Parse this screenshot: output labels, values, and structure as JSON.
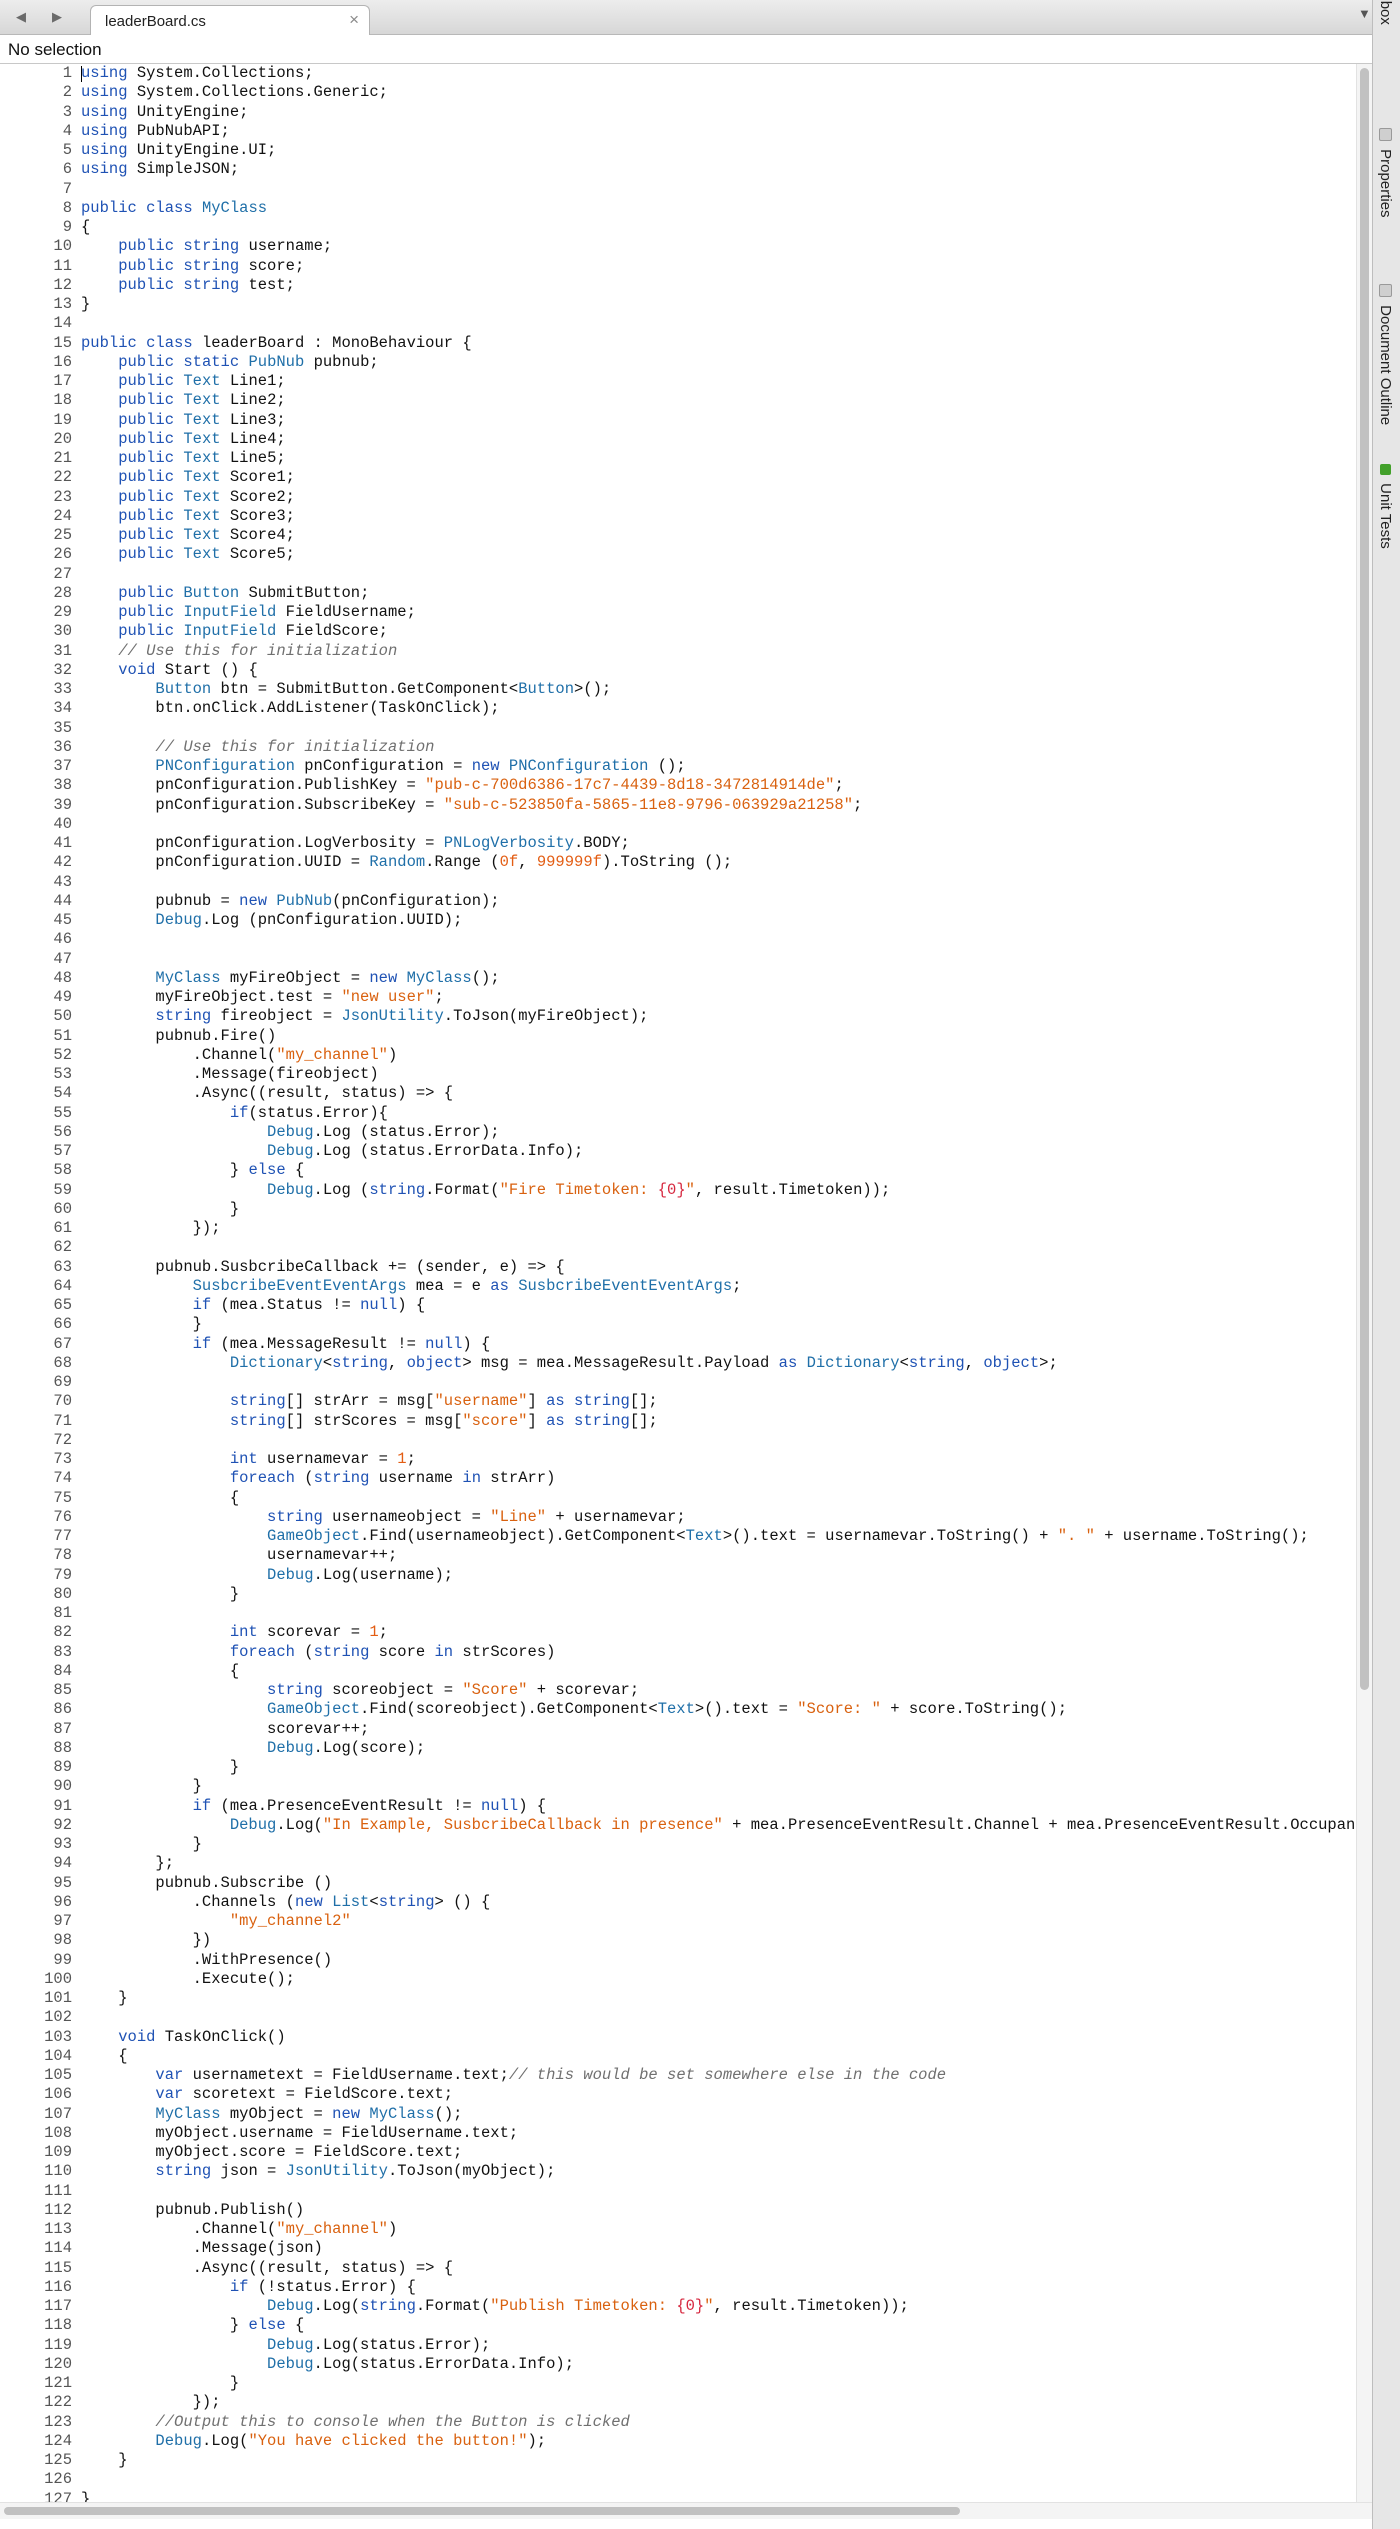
{
  "tab_bar": {
    "back_glyph": "◀",
    "forward_glyph": "▶",
    "tab_title": "leaderBoard.cs",
    "close_glyph": "×",
    "menu_glyph": "▼"
  },
  "selection_status": "No selection",
  "side_panel": {
    "tabs": [
      "Toolbox",
      "Properties",
      "Document Outline",
      "Unit Tests"
    ]
  },
  "editor": {
    "colors": {
      "keyword": "#1f52b4",
      "type": "#1f6fa8",
      "string": "#d9610f",
      "number": "#e35d13",
      "comment": "#707070",
      "placeholder": "#d6263e"
    },
    "lines": [
      "using System.Collections;",
      "using System.Collections.Generic;",
      "using UnityEngine;",
      "using PubNubAPI;",
      "using UnityEngine.UI;",
      "using SimpleJSON;",
      "",
      "public class MyClass",
      "{",
      "    public string username;",
      "    public string score;",
      "    public string test;",
      "}",
      "",
      "public class leaderBoard : MonoBehaviour {",
      "    public static PubNub pubnub;",
      "    public Text Line1;",
      "    public Text Line2;",
      "    public Text Line3;",
      "    public Text Line4;",
      "    public Text Line5;",
      "    public Text Score1;",
      "    public Text Score2;",
      "    public Text Score3;",
      "    public Text Score4;",
      "    public Text Score5;",
      "",
      "    public Button SubmitButton;",
      "    public InputField FieldUsername;",
      "    public InputField FieldScore;",
      "    // Use this for initialization",
      "    void Start () {",
      "        Button btn = SubmitButton.GetComponent<Button>();",
      "        btn.onClick.AddListener(TaskOnClick);",
      "",
      "        // Use this for initialization",
      "        PNConfiguration pnConfiguration = new PNConfiguration ();",
      "        pnConfiguration.PublishKey = \"pub-c-700d6386-17c7-4439-8d18-3472814914de\";",
      "        pnConfiguration.SubscribeKey = \"sub-c-523850fa-5865-11e8-9796-063929a21258\";",
      "",
      "        pnConfiguration.LogVerbosity = PNLogVerbosity.BODY;",
      "        pnConfiguration.UUID = Random.Range (0f, 999999f).ToString ();",
      "",
      "        pubnub = new PubNub(pnConfiguration);",
      "        Debug.Log (pnConfiguration.UUID);",
      "",
      "",
      "        MyClass myFireObject = new MyClass();",
      "        myFireObject.test = \"new user\";",
      "        string fireobject = JsonUtility.ToJson(myFireObject);",
      "        pubnub.Fire()",
      "            .Channel(\"my_channel\")",
      "            .Message(fireobject)",
      "            .Async((result, status) => {",
      "                if(status.Error){",
      "                    Debug.Log (status.Error);",
      "                    Debug.Log (status.ErrorData.Info);",
      "                } else {",
      "                    Debug.Log (string.Format(\"Fire Timetoken: {0}\", result.Timetoken));",
      "                }",
      "            });",
      "",
      "        pubnub.SusbcribeCallback += (sender, e) => {",
      "            SusbcribeEventEventArgs mea = e as SusbcribeEventEventArgs;",
      "            if (mea.Status != null) {",
      "            }",
      "            if (mea.MessageResult != null) {",
      "                Dictionary<string, object> msg = mea.MessageResult.Payload as Dictionary<string, object>;",
      "",
      "                string[] strArr = msg[\"username\"] as string[];",
      "                string[] strScores = msg[\"score\"] as string[];",
      "",
      "                int usernamevar = 1;",
      "                foreach (string username in strArr)",
      "                {",
      "                    string usernameobject = \"Line\" + usernamevar;",
      "                    GameObject.Find(usernameobject).GetComponent<Text>().text = usernamevar.ToString() + \". \" + username.ToString();",
      "                    usernamevar++;",
      "                    Debug.Log(username);",
      "                }",
      "",
      "                int scorevar = 1;",
      "                foreach (string score in strScores)",
      "                {",
      "                    string scoreobject = \"Score\" + scorevar;",
      "                    GameObject.Find(scoreobject).GetComponent<Text>().text = \"Score: \" + score.ToString();",
      "                    scorevar++;",
      "                    Debug.Log(score);",
      "                }",
      "            }",
      "            if (mea.PresenceEventResult != null) {",
      "                Debug.Log(\"In Example, SusbcribeCallback in presence\" + mea.PresenceEventResult.Channel + mea.PresenceEventResult.Occupancy +",
      "            }",
      "        };",
      "        pubnub.Subscribe ()",
      "            .Channels (new List<string> () {",
      "                \"my_channel2\"",
      "            })",
      "            .WithPresence()",
      "            .Execute();",
      "    }",
      "",
      "    void TaskOnClick()",
      "    {",
      "        var usernametext = FieldUsername.text;// this would be set somewhere else in the code",
      "        var scoretext = FieldScore.text;",
      "        MyClass myObject = new MyClass();",
      "        myObject.username = FieldUsername.text;",
      "        myObject.score = FieldScore.text;",
      "        string json = JsonUtility.ToJson(myObject);",
      "",
      "        pubnub.Publish()",
      "            .Channel(\"my_channel\")",
      "            .Message(json)",
      "            .Async((result, status) => {",
      "                if (!status.Error) {",
      "                    Debug.Log(string.Format(\"Publish Timetoken: {0}\", result.Timetoken));",
      "                } else {",
      "                    Debug.Log(status.Error);",
      "                    Debug.Log(status.ErrorData.Info);",
      "                }",
      "            });",
      "        //Output this to console when the Button is clicked",
      "        Debug.Log(\"You have clicked the button!\");",
      "    }",
      "",
      "}"
    ]
  }
}
